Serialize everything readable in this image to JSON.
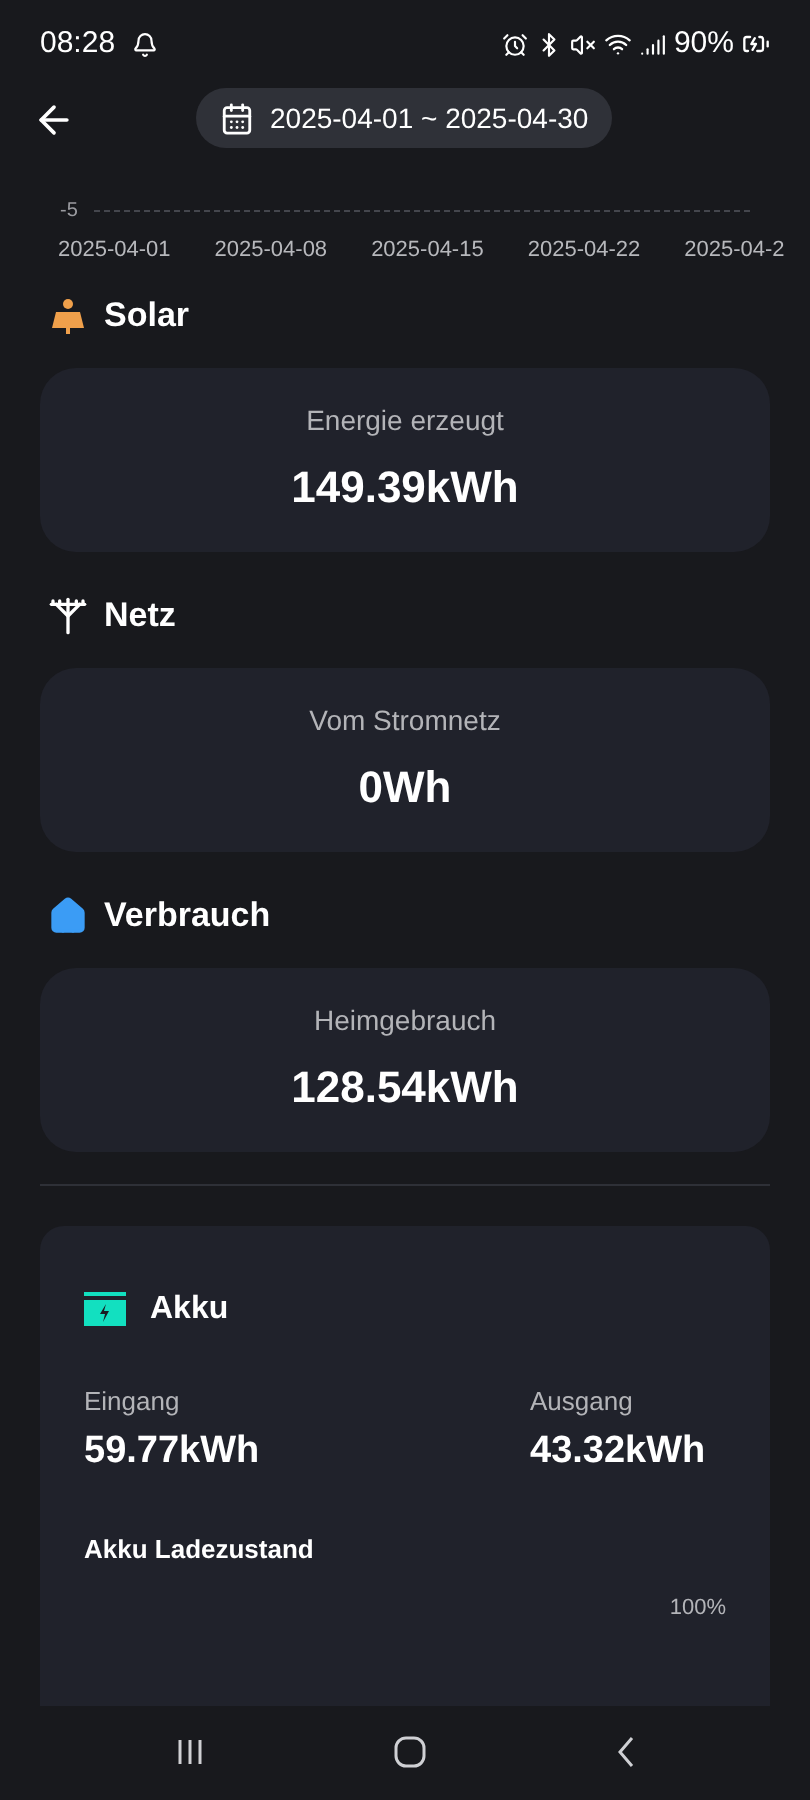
{
  "status_bar": {
    "time": "08:28",
    "battery": "90%"
  },
  "header": {
    "date_range": "2025-04-01 ~ 2025-04-30"
  },
  "chart_axis": {
    "y_tick": "-5",
    "x_labels": [
      "2025-04-01",
      "2025-04-08",
      "2025-04-15",
      "2025-04-22",
      "2025-04-2"
    ]
  },
  "sections": [
    {
      "kind": "solar",
      "title": "Solar",
      "label": "Energie erzeugt",
      "value": "149.39kWh"
    },
    {
      "kind": "grid",
      "title": "Netz",
      "label": "Vom Stromnetz",
      "value": "0Wh"
    },
    {
      "kind": "home",
      "title": "Verbrauch",
      "label": "Heimgebrauch",
      "value": "128.54kWh"
    }
  ],
  "battery": {
    "title": "Akku",
    "input_label": "Eingang",
    "input_value": "59.77kWh",
    "output_label": "Ausgang",
    "output_value": "43.32kWh",
    "soc_title": "Akku Ladezustand",
    "soc_value": "100%"
  }
}
